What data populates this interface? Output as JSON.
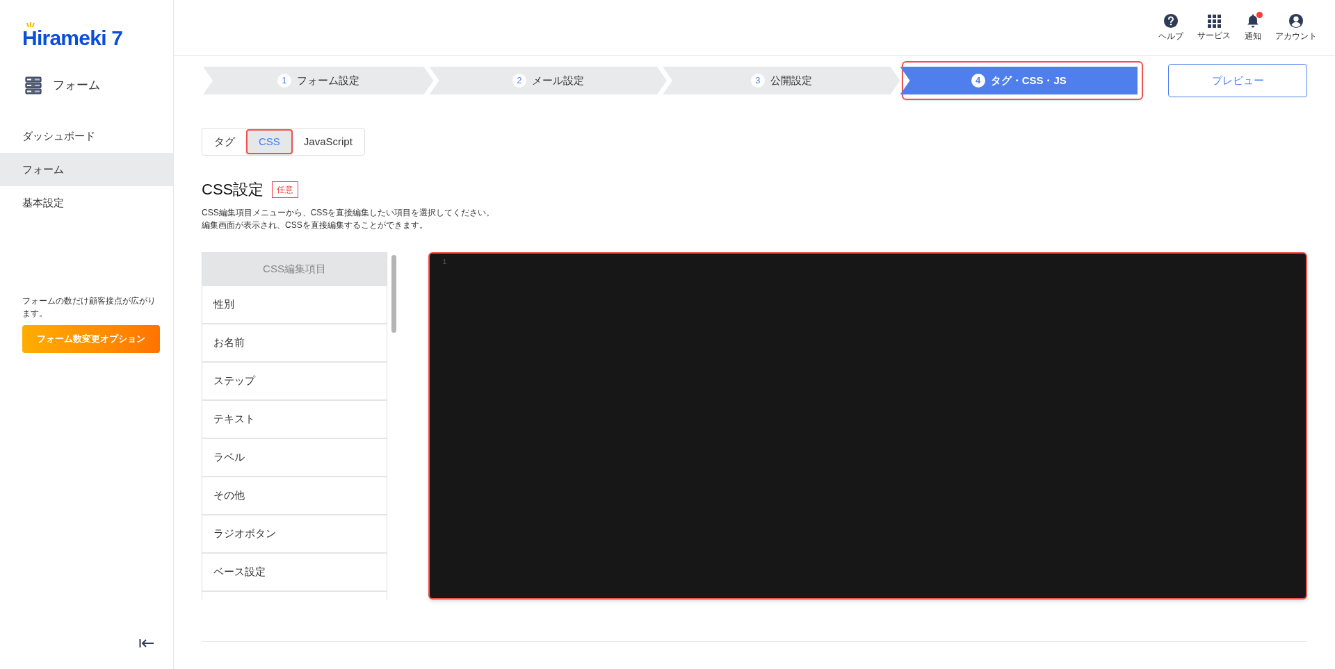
{
  "logo": {
    "text": "Hirameki 7"
  },
  "sidebar": {
    "section": "フォーム",
    "items": [
      {
        "label": "ダッシュボード",
        "selected": false
      },
      {
        "label": "フォーム",
        "selected": true
      },
      {
        "label": "基本設定",
        "selected": false
      }
    ],
    "promo_text": "フォームの数だけ顧客接点が広がります。",
    "promo_button": "フォーム数変更オプション"
  },
  "header": {
    "actions": [
      {
        "label": "ヘルプ",
        "kind": "help",
        "badge": false
      },
      {
        "label": "サービス",
        "kind": "grid",
        "badge": false
      },
      {
        "label": "通知",
        "kind": "bell",
        "badge": true
      },
      {
        "label": "アカウント",
        "kind": "user",
        "badge": false
      }
    ]
  },
  "steps": [
    {
      "number": "1",
      "label": "フォーム設定",
      "selected": false
    },
    {
      "number": "2",
      "label": "メール設定",
      "selected": false
    },
    {
      "number": "3",
      "label": "公開設定",
      "selected": false
    },
    {
      "number": "4",
      "label": "タグ・CSS・JS",
      "selected": true
    }
  ],
  "preview_button": "プレビュー",
  "tabs": [
    {
      "label": "タグ",
      "selected": false
    },
    {
      "label": "CSS",
      "selected": true
    },
    {
      "label": "JavaScript",
      "selected": false
    }
  ],
  "section": {
    "title": "CSS設定",
    "badge": "任意",
    "description": [
      "CSS編集項目メニューから、CSSを直接編集したい項目を選択してください。",
      "編集画面が表示され、CSSを直接編集することができます。"
    ]
  },
  "css_items": {
    "header": "CSS編集項目",
    "items": [
      "性別",
      "お名前",
      "ステップ",
      "テキスト",
      "ラベル",
      "その他",
      "ラジオボタン",
      "ベース設定"
    ]
  },
  "editor": {
    "line_numbers": [
      "1"
    ]
  }
}
